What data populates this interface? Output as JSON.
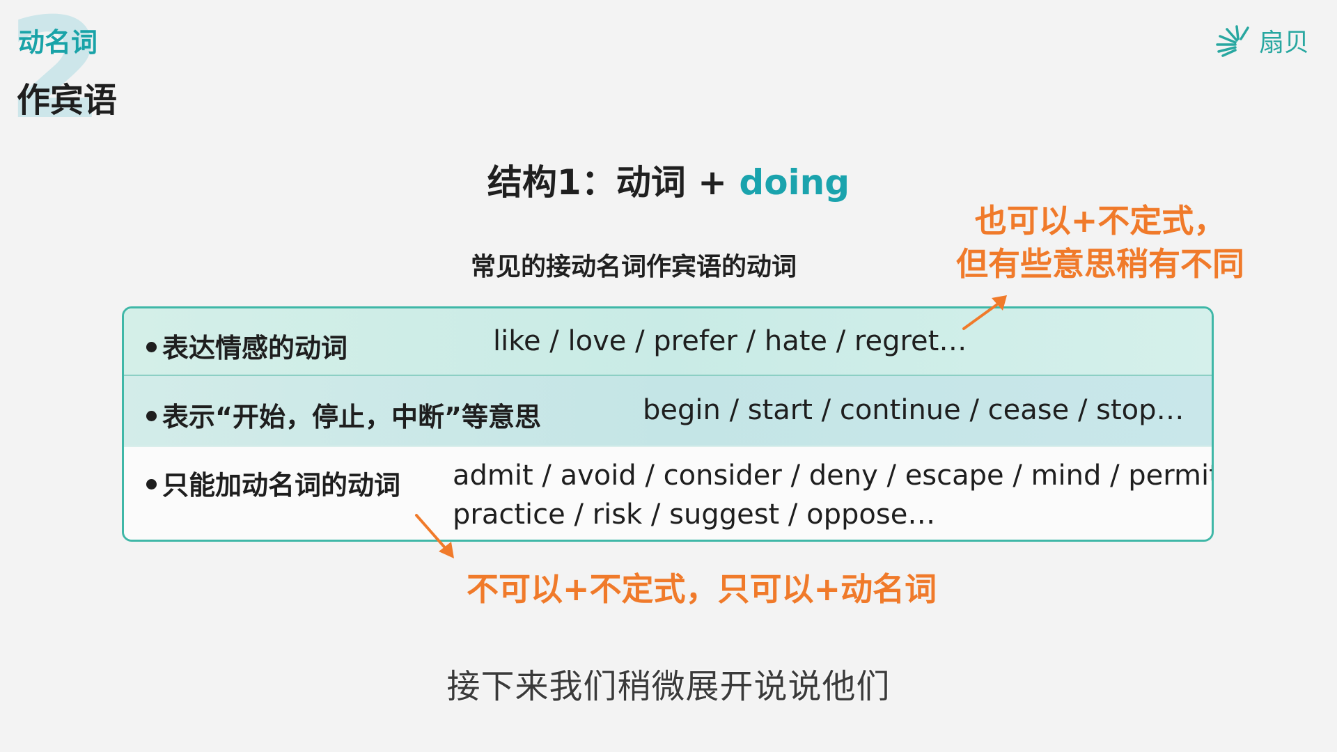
{
  "section": {
    "number": "2",
    "subtitle": "动名词",
    "title": "作宾语"
  },
  "logo": {
    "text": "扇贝",
    "icon": "shell-rays-icon"
  },
  "heading": {
    "prefix": "结构1：动词 + ",
    "accent": "doing"
  },
  "subheading": "常见的接动名词作宾语的动词",
  "notes": {
    "top_line1": "也可以+不定式，",
    "top_line2": "但有些意思稍有不同",
    "bottom": "不可以+不定式，只可以+动名词"
  },
  "table": {
    "rows": [
      {
        "label": "表达情感的动词",
        "verbs": "like / love / prefer / hate / regret…"
      },
      {
        "label": "表示“开始，停止，中断”等意思",
        "verbs": "begin / start / continue / cease / stop…"
      },
      {
        "label": "只能加动名词的动词",
        "verbs_line1": "admit / avoid / consider / deny / escape / mind / permit /",
        "verbs_line2": "practice / risk / suggest / oppose…"
      }
    ]
  },
  "caption": "接下来我们稍微展开说说他们",
  "colors": {
    "accent_teal": "#1aa3ad",
    "annotation_orange": "#f07a2a",
    "table_border": "#3fb7a7"
  }
}
